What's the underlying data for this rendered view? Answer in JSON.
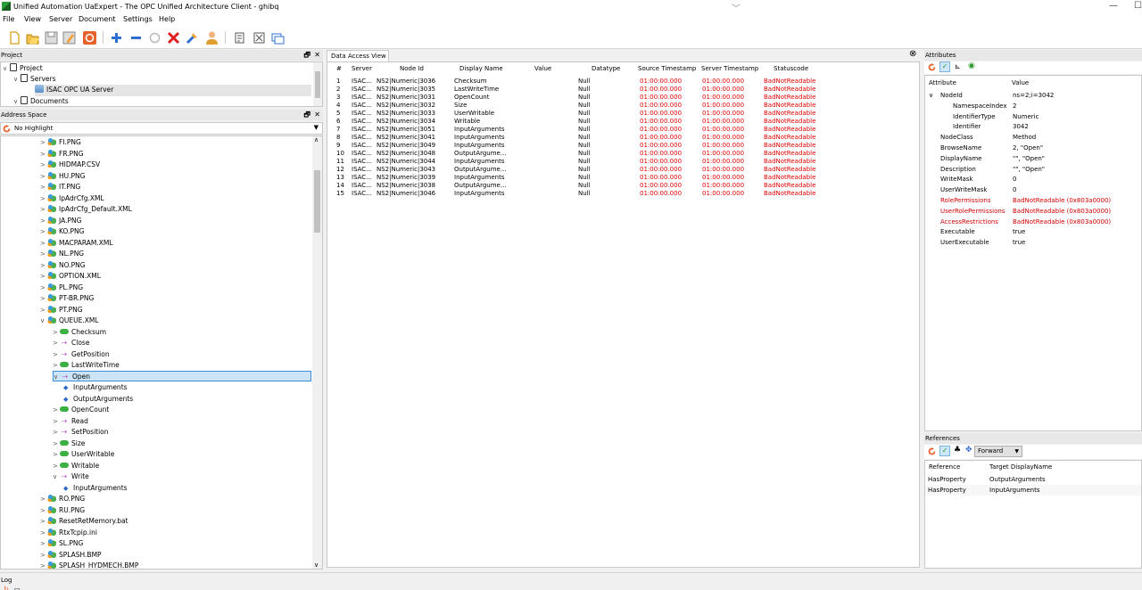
{
  "window": {
    "title": "Unified Automation UaExpert - The OPC Unified Architecture Client - ghibq",
    "minimize": "—",
    "restore": "☐"
  },
  "menu": [
    "File",
    "View",
    "Server",
    "Document",
    "Settings",
    "Help"
  ],
  "project": {
    "header": "Project",
    "items": [
      {
        "label": "Project",
        "level": 0,
        "expand": "∨",
        "icon": "folder-icon"
      },
      {
        "label": "Servers",
        "level": 1,
        "expand": "∨",
        "icon": "folder-icon"
      },
      {
        "label": "ISAC OPC UA Server",
        "level": 2,
        "expand": "",
        "icon": "server-icon",
        "selected": true
      },
      {
        "label": "Documents",
        "level": 1,
        "expand": "∨",
        "icon": "folder-icon"
      }
    ]
  },
  "address_space": {
    "header": "Address Space",
    "highlight": "No Highlight",
    "items": [
      {
        "label": "FI.PNG",
        "level": 0,
        "expand": ">",
        "type": "file"
      },
      {
        "label": "FR.PNG",
        "level": 0,
        "expand": ">",
        "type": "file"
      },
      {
        "label": "HIDMAP.CSV",
        "level": 0,
        "expand": ">",
        "type": "file"
      },
      {
        "label": "HU.PNG",
        "level": 0,
        "expand": ">",
        "type": "file"
      },
      {
        "label": "IT.PNG",
        "level": 0,
        "expand": ">",
        "type": "file"
      },
      {
        "label": "IpAdrCfg.XML",
        "level": 0,
        "expand": ">",
        "type": "file"
      },
      {
        "label": "IpAdrCfg_Default.XML",
        "level": 0,
        "expand": ">",
        "type": "file"
      },
      {
        "label": "JA.PNG",
        "level": 0,
        "expand": ">",
        "type": "file"
      },
      {
        "label": "KO.PNG",
        "level": 0,
        "expand": ">",
        "type": "file"
      },
      {
        "label": "MACPARAM.XML",
        "level": 0,
        "expand": ">",
        "type": "file"
      },
      {
        "label": "NL.PNG",
        "level": 0,
        "expand": ">",
        "type": "file"
      },
      {
        "label": "NO.PNG",
        "level": 0,
        "expand": ">",
        "type": "file"
      },
      {
        "label": "OPTION.XML",
        "level": 0,
        "expand": ">",
        "type": "file"
      },
      {
        "label": "PL.PNG",
        "level": 0,
        "expand": ">",
        "type": "file"
      },
      {
        "label": "PT-BR.PNG",
        "level": 0,
        "expand": ">",
        "type": "file"
      },
      {
        "label": "PT.PNG",
        "level": 0,
        "expand": ">",
        "type": "file"
      },
      {
        "label": "QUEUE.XML",
        "level": 0,
        "expand": "∨",
        "type": "file"
      },
      {
        "label": "Checksum",
        "level": 1,
        "expand": ">",
        "type": "var"
      },
      {
        "label": "Close",
        "level": 1,
        "expand": ">",
        "type": "method"
      },
      {
        "label": "GetPosition",
        "level": 1,
        "expand": ">",
        "type": "method"
      },
      {
        "label": "LastWriteTime",
        "level": 1,
        "expand": ">",
        "type": "var"
      },
      {
        "label": "Open",
        "level": 1,
        "expand": "∨",
        "type": "method",
        "selected": true
      },
      {
        "label": "InputArguments",
        "level": 2,
        "expand": "",
        "type": "prop"
      },
      {
        "label": "OutputArguments",
        "level": 2,
        "expand": "",
        "type": "prop"
      },
      {
        "label": "OpenCount",
        "level": 1,
        "expand": ">",
        "type": "var"
      },
      {
        "label": "Read",
        "level": 1,
        "expand": ">",
        "type": "method"
      },
      {
        "label": "SetPosition",
        "level": 1,
        "expand": ">",
        "type": "method"
      },
      {
        "label": "Size",
        "level": 1,
        "expand": ">",
        "type": "var"
      },
      {
        "label": "UserWritable",
        "level": 1,
        "expand": ">",
        "type": "var"
      },
      {
        "label": "Writable",
        "level": 1,
        "expand": ">",
        "type": "var"
      },
      {
        "label": "Write",
        "level": 1,
        "expand": "∨",
        "type": "method"
      },
      {
        "label": "InputArguments",
        "level": 2,
        "expand": "",
        "type": "prop"
      },
      {
        "label": "RO.PNG",
        "level": 0,
        "expand": ">",
        "type": "file"
      },
      {
        "label": "RU.PNG",
        "level": 0,
        "expand": ">",
        "type": "file"
      },
      {
        "label": "ResetRetMemory.bat",
        "level": 0,
        "expand": ">",
        "type": "file"
      },
      {
        "label": "RtxTcpip.ini",
        "level": 0,
        "expand": ">",
        "type": "file"
      },
      {
        "label": "SL.PNG",
        "level": 0,
        "expand": ">",
        "type": "file"
      },
      {
        "label": "SPLASH.BMP",
        "level": 0,
        "expand": ">",
        "type": "file"
      },
      {
        "label": "SPLASH_HYDMECH.BMP",
        "level": 0,
        "expand": ">",
        "type": "file"
      }
    ]
  },
  "data_access": {
    "tab": "Data Access View",
    "columns": [
      "#",
      "Server",
      "Node Id",
      "Display Name",
      "Value",
      "Datatype",
      "Source Timestamp",
      "Server Timestamp",
      "Statuscode"
    ],
    "rows": [
      [
        "1",
        "ISAC...",
        "NS2|Numeric|3036",
        "Checksum",
        "",
        "Null",
        "01:00:00.000",
        "01:00:00.000",
        "BadNotReadable"
      ],
      [
        "2",
        "ISAC...",
        "NS2|Numeric|3035",
        "LastWriteTime",
        "",
        "Null",
        "01:00:00.000",
        "01:00:00.000",
        "BadNotReadable"
      ],
      [
        "3",
        "ISAC...",
        "NS2|Numeric|3031",
        "OpenCount",
        "",
        "Null",
        "01:00:00.000",
        "01:00:00.000",
        "BadNotReadable"
      ],
      [
        "4",
        "ISAC...",
        "NS2|Numeric|3032",
        "Size",
        "",
        "Null",
        "01:00:00.000",
        "01:00:00.000",
        "BadNotReadable"
      ],
      [
        "5",
        "ISAC...",
        "NS2|Numeric|3033",
        "UserWritable",
        "",
        "Null",
        "01:00:00.000",
        "01:00:00.000",
        "BadNotReadable"
      ],
      [
        "6",
        "ISAC...",
        "NS2|Numeric|3034",
        "Writable",
        "",
        "Null",
        "01:00:00.000",
        "01:00:00.000",
        "BadNotReadable"
      ],
      [
        "7",
        "ISAC...",
        "NS2|Numeric|3051",
        "InputArguments",
        "",
        "Null",
        "01:00:00.000",
        "01:00:00.000",
        "BadNotReadable"
      ],
      [
        "8",
        "ISAC...",
        "NS2|Numeric|3041",
        "InputArguments",
        "",
        "Null",
        "01:00:00.000",
        "01:00:00.000",
        "BadNotReadable"
      ],
      [
        "9",
        "ISAC...",
        "NS2|Numeric|3049",
        "InputArguments",
        "",
        "Null",
        "01:00:00.000",
        "01:00:00.000",
        "BadNotReadable"
      ],
      [
        "10",
        "ISAC...",
        "NS2|Numeric|3048",
        "OutputArgume...",
        "",
        "Null",
        "01:00:00.000",
        "01:00:00.000",
        "BadNotReadable"
      ],
      [
        "11",
        "ISAC...",
        "NS2|Numeric|3044",
        "InputArguments",
        "",
        "Null",
        "01:00:00.000",
        "01:00:00.000",
        "BadNotReadable"
      ],
      [
        "12",
        "ISAC...",
        "NS2|Numeric|3043",
        "OutputArgume...",
        "",
        "Null",
        "01:00:00.000",
        "01:00:00.000",
        "BadNotReadable"
      ],
      [
        "13",
        "ISAC...",
        "NS2|Numeric|3039",
        "InputArguments",
        "",
        "Null",
        "01:00:00.000",
        "01:00:00.000",
        "BadNotReadable"
      ],
      [
        "14",
        "ISAC...",
        "NS2|Numeric|3038",
        "OutputArgume...",
        "",
        "Null",
        "01:00:00.000",
        "01:00:00.000",
        "BadNotReadable"
      ],
      [
        "15",
        "ISAC...",
        "NS2|Numeric|3046",
        "InputArguments",
        "",
        "Null",
        "01:00:00.000",
        "01:00:00.000",
        "BadNotReadable"
      ]
    ]
  },
  "attributes": {
    "header": "Attributes",
    "columns": [
      "Attribute",
      "Value"
    ],
    "rows": [
      {
        "name": "NodeId",
        "value": "ns=2;i=3042",
        "level": 0,
        "expand": "∨",
        "error": false
      },
      {
        "name": "NamespaceIndex",
        "value": "2",
        "level": 1,
        "expand": "",
        "error": false
      },
      {
        "name": "IdentifierType",
        "value": "Numeric",
        "level": 1,
        "expand": "",
        "error": false
      },
      {
        "name": "Identifier",
        "value": "3042",
        "level": 1,
        "expand": "",
        "error": false
      },
      {
        "name": "NodeClass",
        "value": "Method",
        "level": 0,
        "expand": "",
        "error": false
      },
      {
        "name": "BrowseName",
        "value": "2, \"Open\"",
        "level": 0,
        "expand": "",
        "error": false
      },
      {
        "name": "DisplayName",
        "value": "\"\", \"Open\"",
        "level": 0,
        "expand": "",
        "error": false
      },
      {
        "name": "Description",
        "value": "\"\", \"Open\"",
        "level": 0,
        "expand": "",
        "error": false
      },
      {
        "name": "WriteMask",
        "value": "0",
        "level": 0,
        "expand": "",
        "error": false
      },
      {
        "name": "UserWriteMask",
        "value": "0",
        "level": 0,
        "expand": "",
        "error": false
      },
      {
        "name": "RolePermissions",
        "value": "BadNotReadable (0x803a0000)",
        "level": 0,
        "expand": "",
        "error": true
      },
      {
        "name": "UserRolePermissions",
        "value": "BadNotReadable (0x803a0000)",
        "level": 0,
        "expand": "",
        "error": true
      },
      {
        "name": "AccessRestrictions",
        "value": "BadNotReadable (0x803a0000)",
        "level": 0,
        "expand": "",
        "error": true
      },
      {
        "name": "Executable",
        "value": "true",
        "level": 0,
        "expand": "",
        "error": false
      },
      {
        "name": "UserExecutable",
        "value": "true",
        "level": 0,
        "expand": "",
        "error": false
      }
    ]
  },
  "references": {
    "header": "References",
    "direction": "Forward",
    "columns": [
      "Reference",
      "Target DisplayName"
    ],
    "rows": [
      [
        "HasProperty",
        "OutputArguments"
      ],
      [
        "HasProperty",
        "InputArguments"
      ]
    ]
  },
  "log": {
    "header": "Log"
  },
  "colors": {
    "accent": "#3b8ed8",
    "error": "#e00000",
    "selected_bg": "#cce4f7"
  }
}
